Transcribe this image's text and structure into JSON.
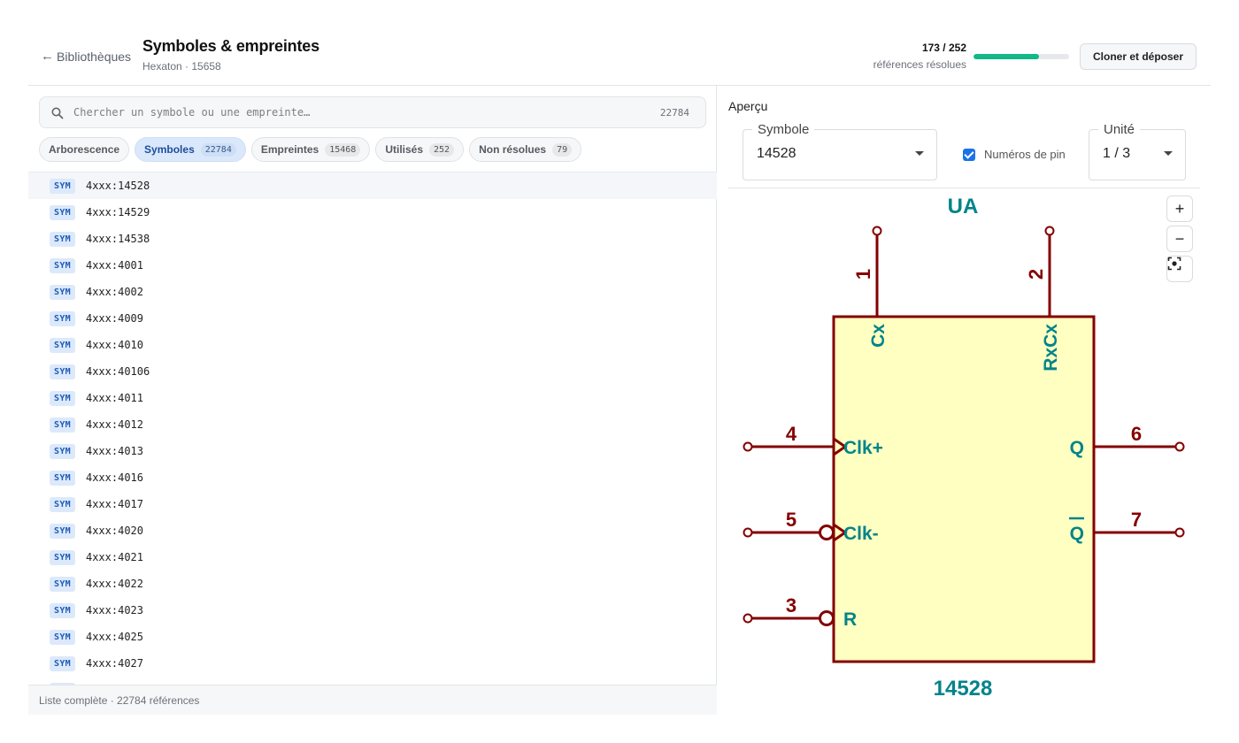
{
  "header": {
    "back_label": "Bibliothèques",
    "title": "Symboles & empreintes",
    "subtitle": "Hexaton · 15658",
    "progress_count": "173 / 252",
    "progress_label": "références résolues",
    "progress_fraction": 0.6865,
    "clone_button": "Cloner et déposer"
  },
  "search": {
    "placeholder": "Chercher un symbole ou une empreinte…",
    "count": "22784"
  },
  "tabs": [
    {
      "label": "Arborescence",
      "badge": ""
    },
    {
      "label": "Symboles",
      "badge": "22784",
      "active": true
    },
    {
      "label": "Empreintes",
      "badge": "15468"
    },
    {
      "label": "Utilisés",
      "badge": "252"
    },
    {
      "label": "Non résolues",
      "badge": "79"
    }
  ],
  "list": {
    "badge": "SYM",
    "items": [
      "4xxx:14528",
      "4xxx:14529",
      "4xxx:14538",
      "4xxx:4001",
      "4xxx:4002",
      "4xxx:4009",
      "4xxx:4010",
      "4xxx:40106",
      "4xxx:4011",
      "4xxx:4012",
      "4xxx:4013",
      "4xxx:4016",
      "4xxx:4017",
      "4xxx:4020",
      "4xxx:4021",
      "4xxx:4022",
      "4xxx:4023",
      "4xxx:4025",
      "4xxx:4027"
    ],
    "footer": "Liste complète · 22784 références"
  },
  "preview": {
    "label": "Aperçu",
    "symbol_field_label": "Symbole",
    "symbol_value": "14528",
    "pin_numbers_label": "Numéros de pin",
    "pin_numbers_checked": true,
    "unit_field_label": "Unité",
    "unit_value": "1 / 3",
    "zoom_in": "+",
    "zoom_out": "−"
  },
  "schematic": {
    "reference": "UA",
    "value": "14528",
    "body_fill": "#ffffc2",
    "outline_color": "#840000",
    "text_color": "#00848a",
    "pins": {
      "cx_number": "1",
      "cx_name": "Cx",
      "rxcx_number": "2",
      "rxcx_name": "RxCx",
      "clk_plus_number": "4",
      "clk_plus_name": "Clk+",
      "clk_minus_number": "5",
      "clk_minus_name": "Clk-",
      "r_number": "3",
      "r_name": "R",
      "q_number": "6",
      "q_name": "Q",
      "qbar_number": "7",
      "qbar_name": "Q"
    }
  }
}
